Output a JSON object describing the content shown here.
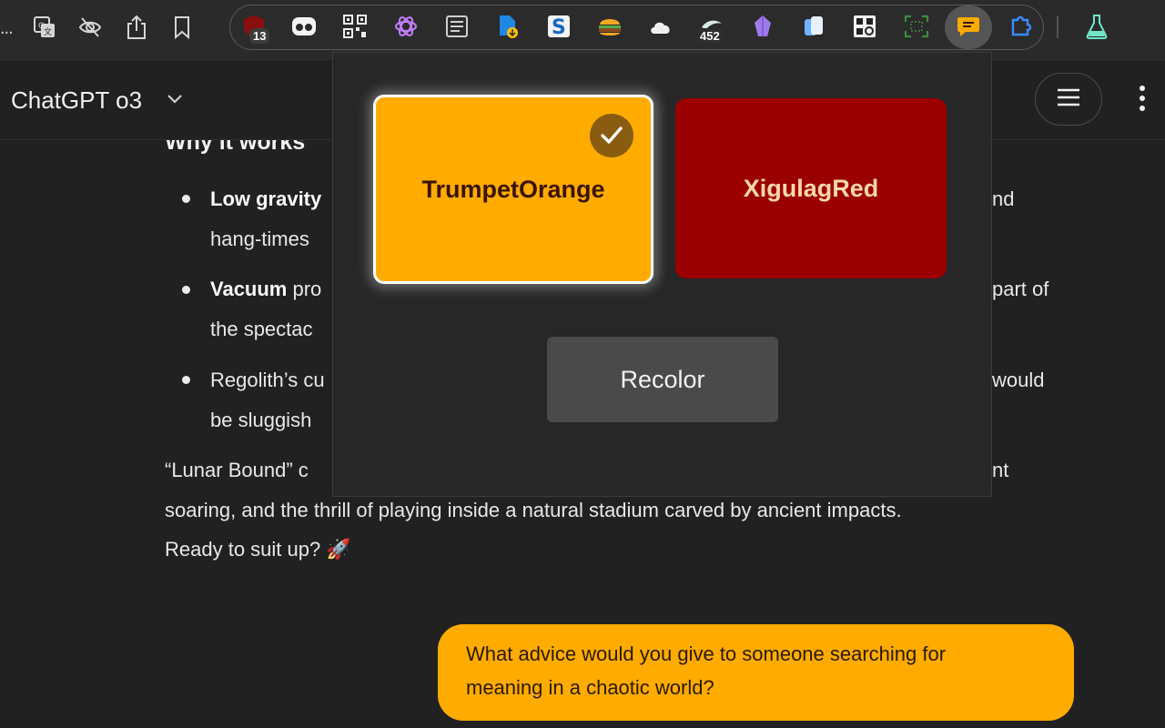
{
  "toolbar": {
    "overflow_label": "...",
    "badges": {
      "ublock": "13",
      "counter": "452"
    },
    "icons": [
      "translate-icon",
      "eye-off-icon",
      "share-icon",
      "bookmark-icon",
      "ublock-icon",
      "owl-icon",
      "qr-code-icon",
      "chatgpt-icon",
      "reader-icon",
      "doc-download-icon",
      "s-icon",
      "burger-icon",
      "cloud-icon",
      "bird-icon",
      "crystal-icon",
      "copy-icon",
      "qr-scan-icon",
      "screenshot-icon",
      "chat-recolor-icon",
      "puzzle-icon",
      "flask-icon"
    ]
  },
  "header": {
    "model_name": "ChatGPT o3"
  },
  "chat": {
    "heading": "Why it works",
    "bullets": [
      {
        "bold": "Low gravity",
        "line1_rest": "",
        "line1_tail": "nd",
        "line2": "hang-times"
      },
      {
        "bold": "Vacuum",
        "line1_rest": " pro",
        "line1_tail": "part of",
        "line2": "the spectac"
      },
      {
        "bold": "",
        "line1_rest": "Regolith’s cu",
        "line1_tail": "would",
        "line2": "be sluggish"
      }
    ],
    "para_line1_start": "“Lunar Bound” c",
    "para_line1_tail": "nt",
    "para_line2": "soaring, and the thrill of playing inside a natural stadium carved by ancient impacts.",
    "para_line3": "Ready to suit up? 🚀",
    "user_message_line1": "What advice would you give to someone searching for",
    "user_message_line2": "meaning in a chaotic world?"
  },
  "popup": {
    "option_selected": "TrumpetOrange",
    "option_other": "XigulagRed",
    "recolor_label": "Recolor",
    "colors": {
      "orange": "#ffab00",
      "red": "#9b0000"
    }
  }
}
